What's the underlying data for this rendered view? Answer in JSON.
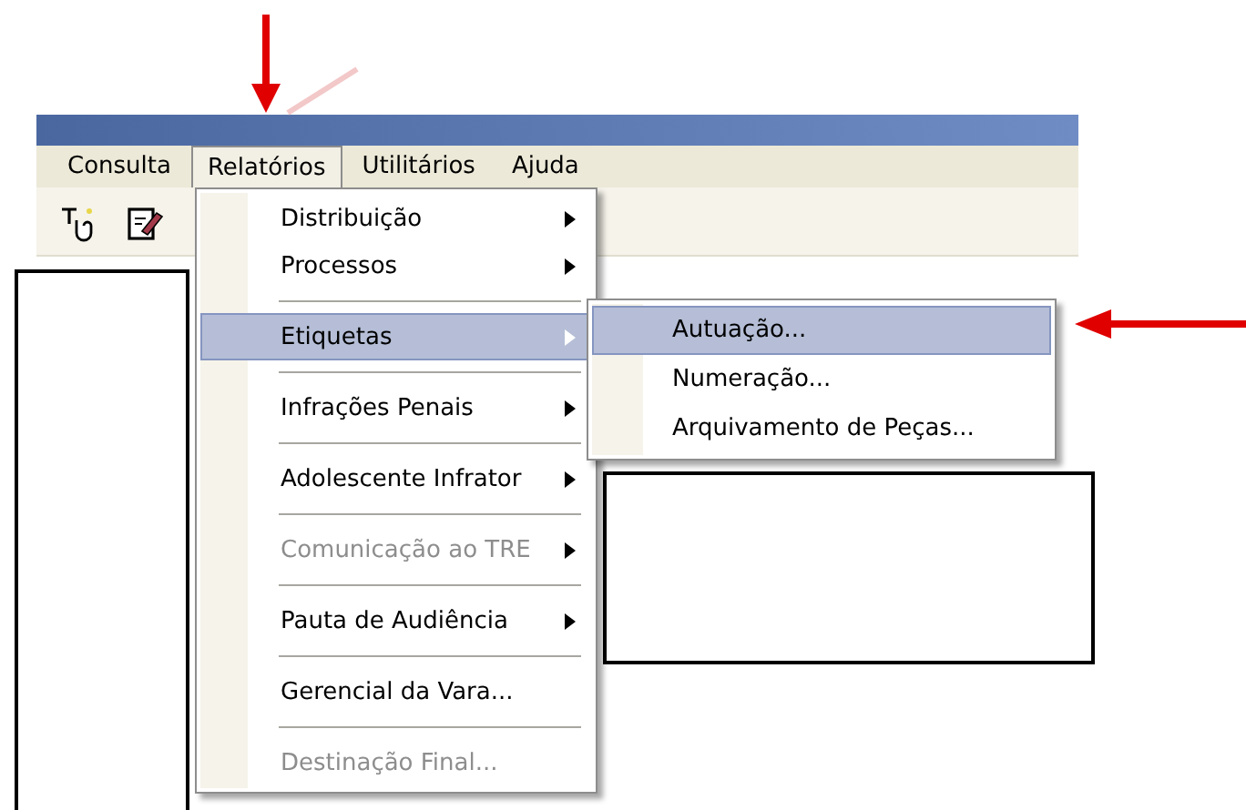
{
  "menubar": [
    {
      "label": "Consulta",
      "selected": false
    },
    {
      "label": "Relatórios",
      "selected": true
    },
    {
      "label": "Utilitários",
      "selected": false
    },
    {
      "label": "Ajuda",
      "selected": false
    }
  ],
  "menu": {
    "items": [
      {
        "kind": "submenu",
        "label": "Distribuição",
        "disabled": false,
        "selected": false
      },
      {
        "kind": "submenu",
        "label": "Processos",
        "disabled": false,
        "selected": false
      },
      {
        "kind": "separator"
      },
      {
        "kind": "submenu",
        "label": "Etiquetas",
        "disabled": false,
        "selected": true
      },
      {
        "kind": "separator"
      },
      {
        "kind": "submenu",
        "label": "Infrações Penais",
        "disabled": false,
        "selected": false
      },
      {
        "kind": "separator"
      },
      {
        "kind": "submenu",
        "label": "Adolescente Infrator",
        "disabled": false,
        "selected": false
      },
      {
        "kind": "separator"
      },
      {
        "kind": "submenu",
        "label": "Comunicação ao TRE",
        "disabled": true,
        "selected": false
      },
      {
        "kind": "separator"
      },
      {
        "kind": "submenu",
        "label": "Pauta de Audiência",
        "disabled": false,
        "selected": false
      },
      {
        "kind": "separator"
      },
      {
        "kind": "command",
        "label": "Gerencial da Vara...",
        "disabled": false,
        "selected": false
      },
      {
        "kind": "separator"
      },
      {
        "kind": "command",
        "label": "Destinação Final...",
        "disabled": true,
        "selected": false
      }
    ]
  },
  "submenu": {
    "items": [
      {
        "label": "Autuação...",
        "selected": true
      },
      {
        "label": "Numeração...",
        "selected": false
      },
      {
        "label": "Arquivamento de Peças...",
        "selected": false
      }
    ]
  }
}
